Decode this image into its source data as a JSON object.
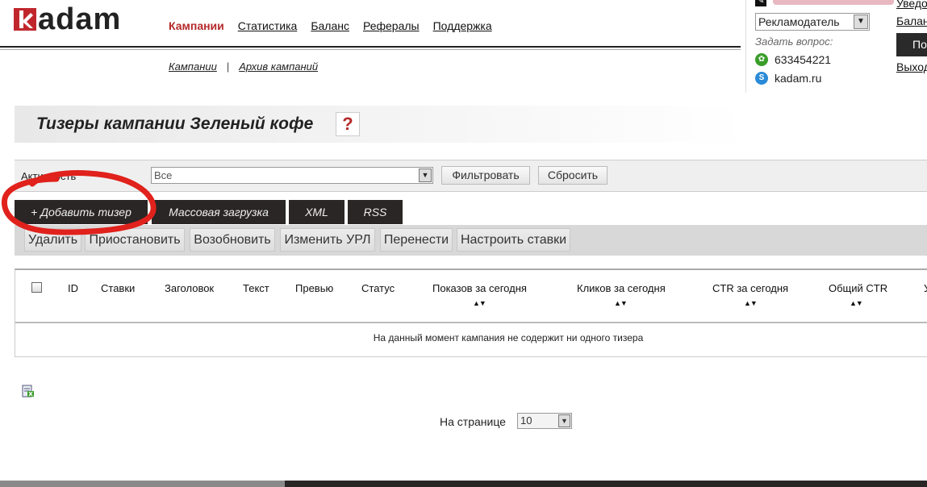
{
  "brand": {
    "logo_text": "adam",
    "logo_letter": "k"
  },
  "main_nav": [
    {
      "label": "Кампании",
      "active": true
    },
    {
      "label": "Статистика",
      "active": false
    },
    {
      "label": "Баланс",
      "active": false
    },
    {
      "label": "Рефералы",
      "active": false
    },
    {
      "label": "Поддержка",
      "active": false
    }
  ],
  "sub_nav": {
    "campaigns": "Кампании",
    "separator": "|",
    "archive": "Архив кампаний"
  },
  "user_panel": {
    "role_selected": "Рекламодатель",
    "ask_label": "Задать вопрос:",
    "icq_number": "633454221",
    "skype_name": "kadam.ru",
    "link_notifications": "Уведо",
    "link_balance": "Балан",
    "dark_button": "По",
    "link_exit": "Выход"
  },
  "page_title": "Тизеры кампании Зеленый кофе",
  "help_symbol": "?",
  "filter": {
    "label": "Активность",
    "selected": "Все",
    "filter_button": "Фильтровать",
    "reset_button": "Сбросить"
  },
  "tabs": {
    "add": "+ Добавить тизер",
    "mass": "Массовая загрузка",
    "xml": "XML",
    "rss": "RSS"
  },
  "actions": {
    "delete": "Удалить",
    "pause": "Приостановить",
    "resume": "Возобновить",
    "change_url": "Изменить УРЛ",
    "move": "Перенести",
    "bids": "Настроить ставки"
  },
  "table": {
    "headers": {
      "id": "ID",
      "bids": "Ставки",
      "title": "Заголовок",
      "text": "Текст",
      "preview": "Превью",
      "status": "Статус",
      "shows_today": "Показов за сегодня",
      "clicks_today": "Кликов за сегодня",
      "ctr_today": "CTR за сегодня",
      "total_ctr": "Общий CTR",
      "cut": "У"
    },
    "sort_symbol": "▲▼",
    "empty_message": "На данный момент кампания не содержит ни одного тизера"
  },
  "pagination": {
    "label": "На странице",
    "per_page": "10"
  },
  "colors": {
    "accent": "#b52a2a",
    "dark": "#2b2626",
    "annotation": "#e0211c"
  }
}
